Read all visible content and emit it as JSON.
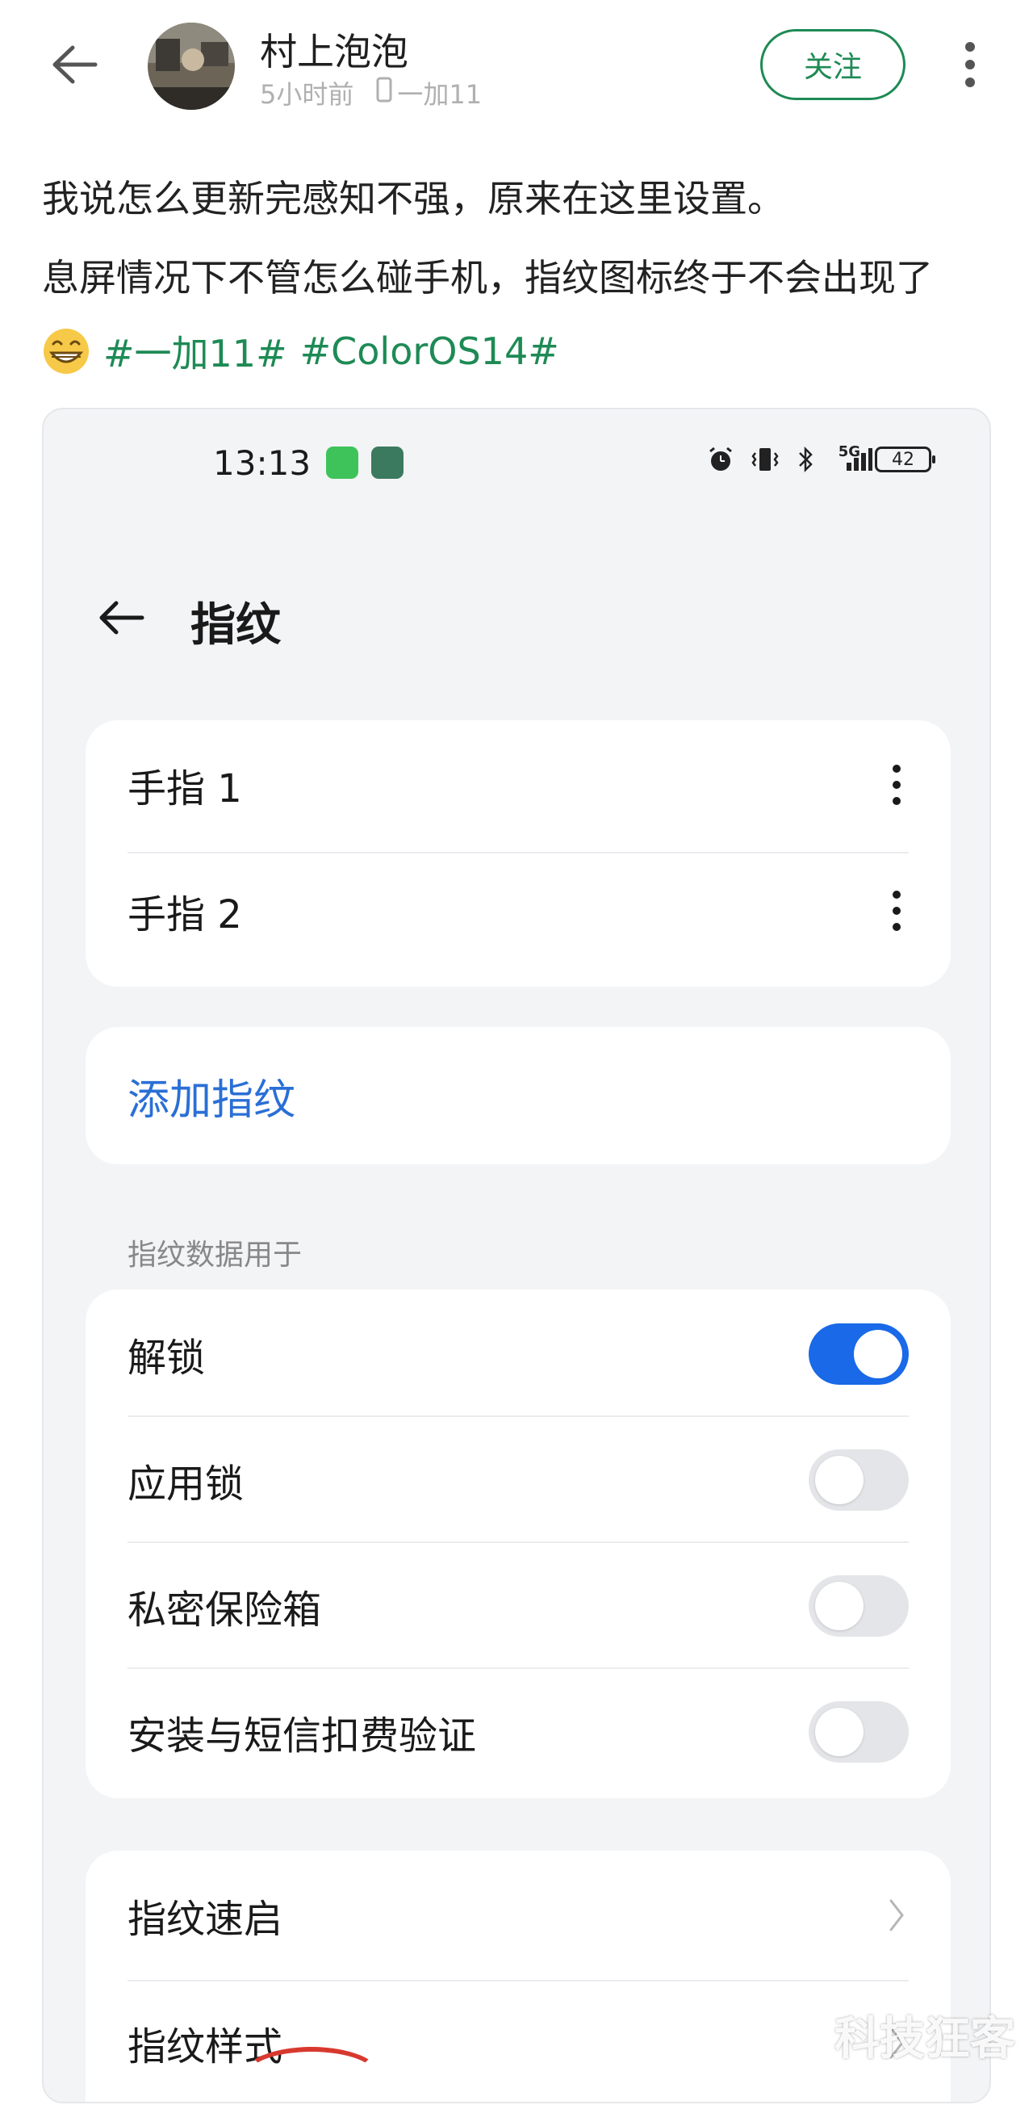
{
  "author": {
    "name": "村上泡泡",
    "time": "5小时前",
    "device": "一加11"
  },
  "actions": {
    "follow": "关注"
  },
  "post": {
    "line1": "我说怎么更新完感知不强，原来在这里设置。",
    "line2": "息屏情况下不管怎么碰手机，指纹图标终于不会出现了",
    "hashtags": [
      "#一加11#",
      "#ColorOS14#"
    ]
  },
  "screenshot": {
    "status": {
      "time": "13:13",
      "network": "5G",
      "battery": "42"
    },
    "title": "指纹",
    "fingers": [
      "手指 1",
      "手指 2"
    ],
    "add_fingerprint": "添加指纹",
    "section_label": "指纹数据用于",
    "toggles": [
      {
        "label": "解锁",
        "on": true
      },
      {
        "label": "应用锁",
        "on": false
      },
      {
        "label": "私密保险箱",
        "on": false
      },
      {
        "label": "安装与短信扣费验证",
        "on": false
      }
    ],
    "nav_items": [
      "指纹速启",
      "指纹样式"
    ]
  },
  "watermark": "科技狂客",
  "colors": {
    "accent_green": "#1e8a55",
    "toggle_on": "#1969e8",
    "link_blue": "#2a6fd6"
  }
}
